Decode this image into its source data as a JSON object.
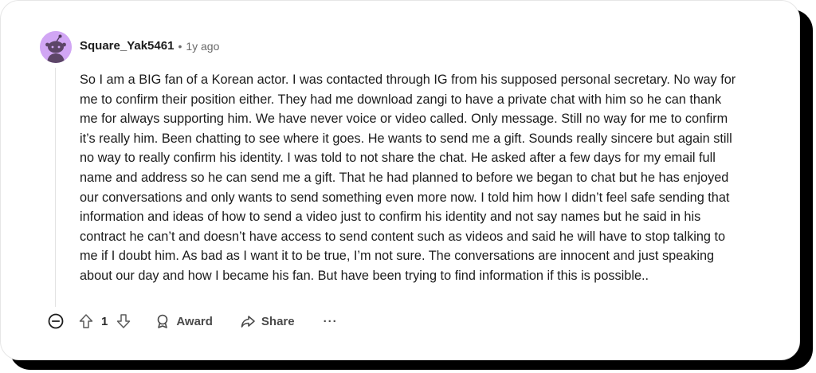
{
  "comment": {
    "username": "Square_Yak5461",
    "separator": "•",
    "timestamp": "1y ago",
    "body": "So I am a BIG fan of a Korean actor. I was contacted through IG from his supposed personal secretary. No way for me to confirm their position either. They had me download zangi to have a private chat with him so he can thank me for always supporting him. We have never voice or video called. Only message. Still no way for me to confirm it’s really him. Been chatting to see where it goes. He wants to send me a gift. Sounds really sincere but again still no way to really confirm his identity. I was told to not share the chat. He asked after a few days for my email full name and address so he can send me a gift. That he had planned to before we began to chat but he has enjoyed our conversations and only wants to send something even more now. I told him how I didn’t feel safe sending that information and ideas of how to send a video just to confirm his identity and not say names but he said in his contract he can’t and doesn’t have access to send content such as videos and said he will have to stop talking to me if I doubt him. As bad as I want it to be true, I’m not sure. The conversations are innocent and just speaking about our day and how I became his fan. But have been trying to find information if this is possible..",
    "avatar_color": "#d1a6f4"
  },
  "actions": {
    "vote_count": "1",
    "award_label": "Award",
    "share_label": "Share",
    "more_label": "···"
  },
  "icons": {
    "collapse": "minus-circle-icon",
    "upvote": "arrow-up-icon",
    "downvote": "arrow-down-icon",
    "award": "award-icon",
    "share": "share-icon",
    "avatar": "snoo-avatar-icon"
  }
}
